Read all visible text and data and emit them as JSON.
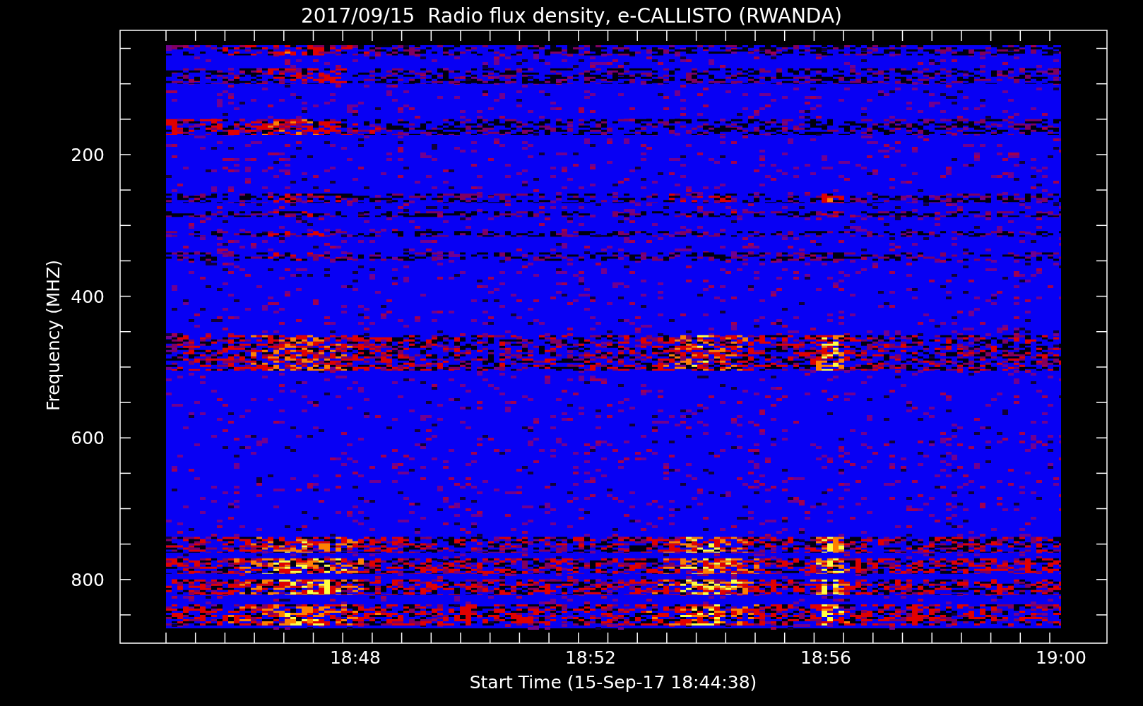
{
  "title": "2017/09/15  Radio flux density, e-CALLISTO (RWANDA)",
  "y_axis": {
    "label": "Frequency (MHZ)",
    "ticks": [
      "200",
      "400",
      "600",
      "800"
    ]
  },
  "x_axis": {
    "label": "Start Time (15-Sep-17 18:44:38)",
    "ticks": [
      "18:48",
      "18:52",
      "18:56",
      "19:00"
    ]
  }
}
